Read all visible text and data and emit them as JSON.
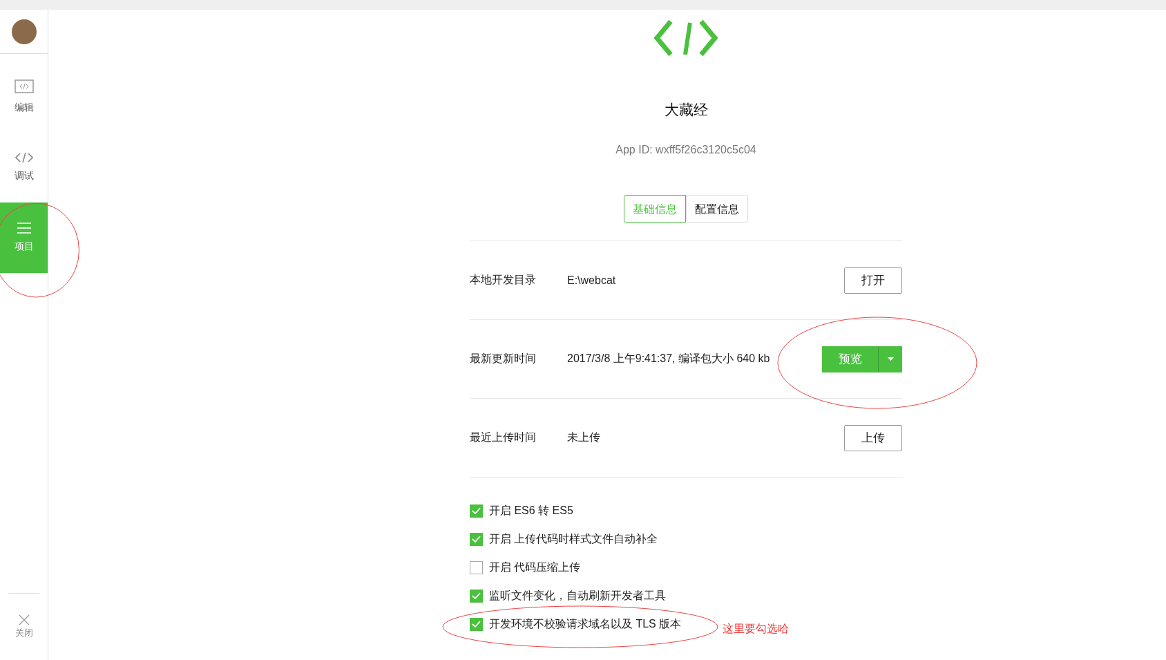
{
  "sidebar": {
    "items": [
      {
        "label": "编辑",
        "kind": "editor",
        "selected": false
      },
      {
        "label": "调试",
        "kind": "debug",
        "selected": false
      },
      {
        "label": "项目",
        "kind": "project",
        "selected": true
      }
    ],
    "close": "关闭"
  },
  "project": {
    "name": "大藏经",
    "app_id": "App ID: wxff5f26c3120c5c04",
    "tabs": [
      {
        "label": "基础信息",
        "selected": true
      },
      {
        "label": "配置信息",
        "selected": false
      }
    ],
    "rows": [
      {
        "label": "本地开发目录",
        "value": "E:\\webcat",
        "action": {
          "kind": "plain",
          "label": "打开"
        }
      },
      {
        "label": "最新更新时间",
        "value": "2017/3/8 上午9:41:37, 编译包大小 640 kb",
        "action": {
          "kind": "split",
          "label": "预览"
        }
      },
      {
        "label": "最近上传时间",
        "value": "未上传",
        "action": {
          "kind": "plain",
          "label": "上传"
        }
      }
    ],
    "options": [
      {
        "label": "开启 ES6 转 ES5",
        "checked": true
      },
      {
        "label": "开启 上传代码时样式文件自动补全",
        "checked": true
      },
      {
        "label": "开启 代码压缩上传",
        "checked": false
      },
      {
        "label": "监听文件变化，自动刷新开发者工具",
        "checked": true
      },
      {
        "label": "开发环境不校验请求域名以及 TLS 版本",
        "checked": true
      }
    ]
  },
  "annotation": {
    "text": "这里要勾选哈"
  }
}
